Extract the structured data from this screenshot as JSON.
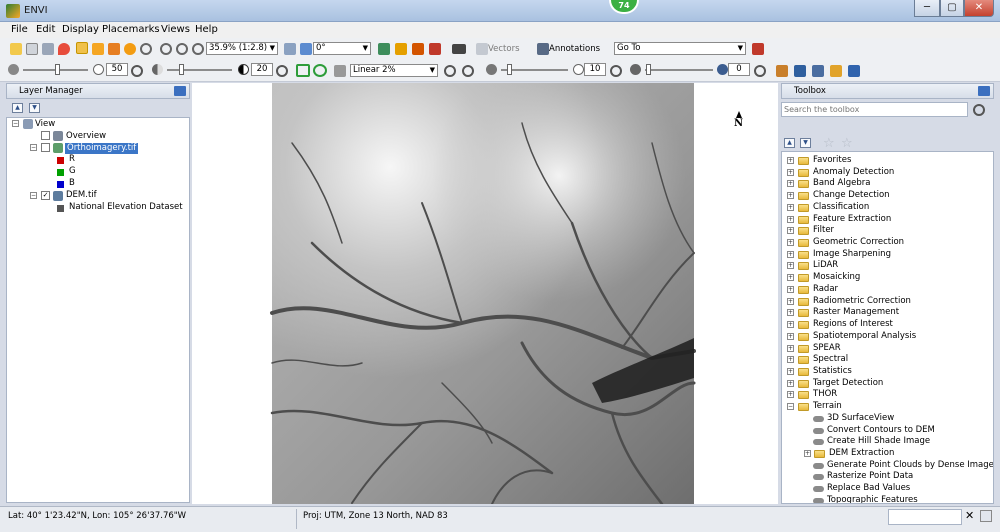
{
  "app": {
    "title": "ENVI",
    "badge": "74",
    "min": "─",
    "max": "▢",
    "close": "✕"
  },
  "menu": [
    "File",
    "Edit",
    "Display",
    "Placemarks",
    "Views",
    "Help"
  ],
  "toolbar1": {
    "zoom": "35.9% (1:2.8)",
    "rotation": "0°",
    "vectors": "Vectors",
    "annotations": "Annotations",
    "goto": "Go To"
  },
  "toolbar2": {
    "brightness": "50",
    "contrast": "20",
    "stretch": "Linear 2%",
    "sharpen": "10",
    "transparency": "0"
  },
  "layer_manager": {
    "title": "Layer Manager",
    "view": "View",
    "overview": "Overview",
    "ortho": "Orthoimagery.tif",
    "band_r": "R",
    "band_g": "G",
    "band_b": "B",
    "dem": "DEM.tif",
    "dem_band": "National Elevation Dataset"
  },
  "toolbox": {
    "title": "Toolbox",
    "search_placeholder": "Search the toolbox",
    "folders": [
      "Favorites",
      "Anomaly Detection",
      "Band Algebra",
      "Change Detection",
      "Classification",
      "Feature Extraction",
      "Filter",
      "Geometric Correction",
      "Image Sharpening",
      "LiDAR",
      "Mosaicking",
      "Radar",
      "Radiometric Correction",
      "Raster Management",
      "Regions of Interest",
      "Spatiotemporal Analysis",
      "SPEAR",
      "Spectral",
      "Statistics",
      "Target Detection",
      "THOR",
      "Terrain"
    ],
    "terrain_items": [
      "3D SurfaceView",
      "Convert Contours to DEM",
      "Create Hill Shade Image"
    ],
    "dem_extraction": "DEM Extraction",
    "terrain_items2": [
      "Generate Point Clouds by Dense Image",
      "Rasterize Point Data",
      "Replace Bad Values",
      "Topographic Features"
    ]
  },
  "map": {
    "north": "N"
  },
  "status": {
    "latlon": "Lat: 40° 1'23.42\"N, Lon: 105° 26'37.76\"W",
    "proj": "Proj: UTM, Zone 13 North, NAD 83"
  },
  "colors": {
    "accent": "#3b76c7",
    "band_r": "#cc0000",
    "band_g": "#00a000",
    "band_b": "#0000cc"
  }
}
